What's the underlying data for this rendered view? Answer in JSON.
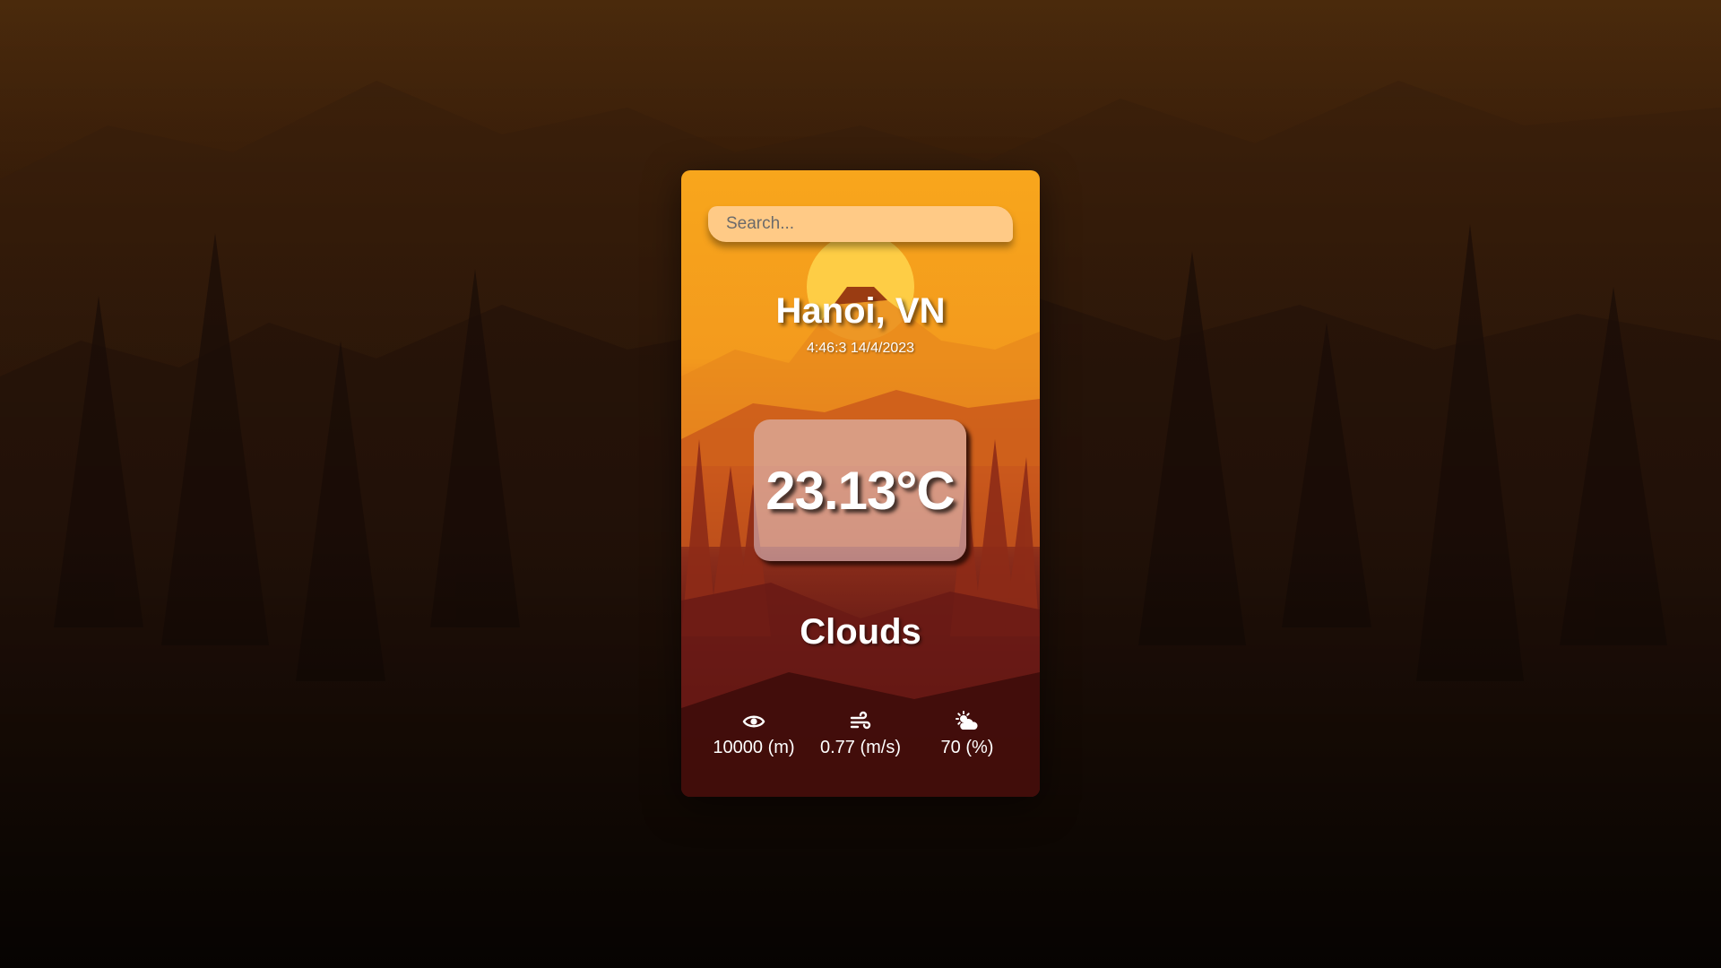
{
  "search": {
    "placeholder": "Search...",
    "value": ""
  },
  "location": {
    "city": "Hanoi, VN",
    "datetime": "4:46:3 14/4/2023"
  },
  "weather": {
    "temperature": "23.13°C",
    "condition": "Clouds"
  },
  "stats": [
    {
      "icon": "eye-icon",
      "value": "10000 (m)"
    },
    {
      "icon": "wind-icon",
      "value": "0.77 (m/s)"
    },
    {
      "icon": "sun-cloud-icon",
      "value": "70 (%)"
    }
  ],
  "colors": {
    "card_top": "#f8a61c",
    "card_bottom": "#3a0b0b",
    "search_bg": "#ffca86",
    "text": "#ffffff"
  }
}
